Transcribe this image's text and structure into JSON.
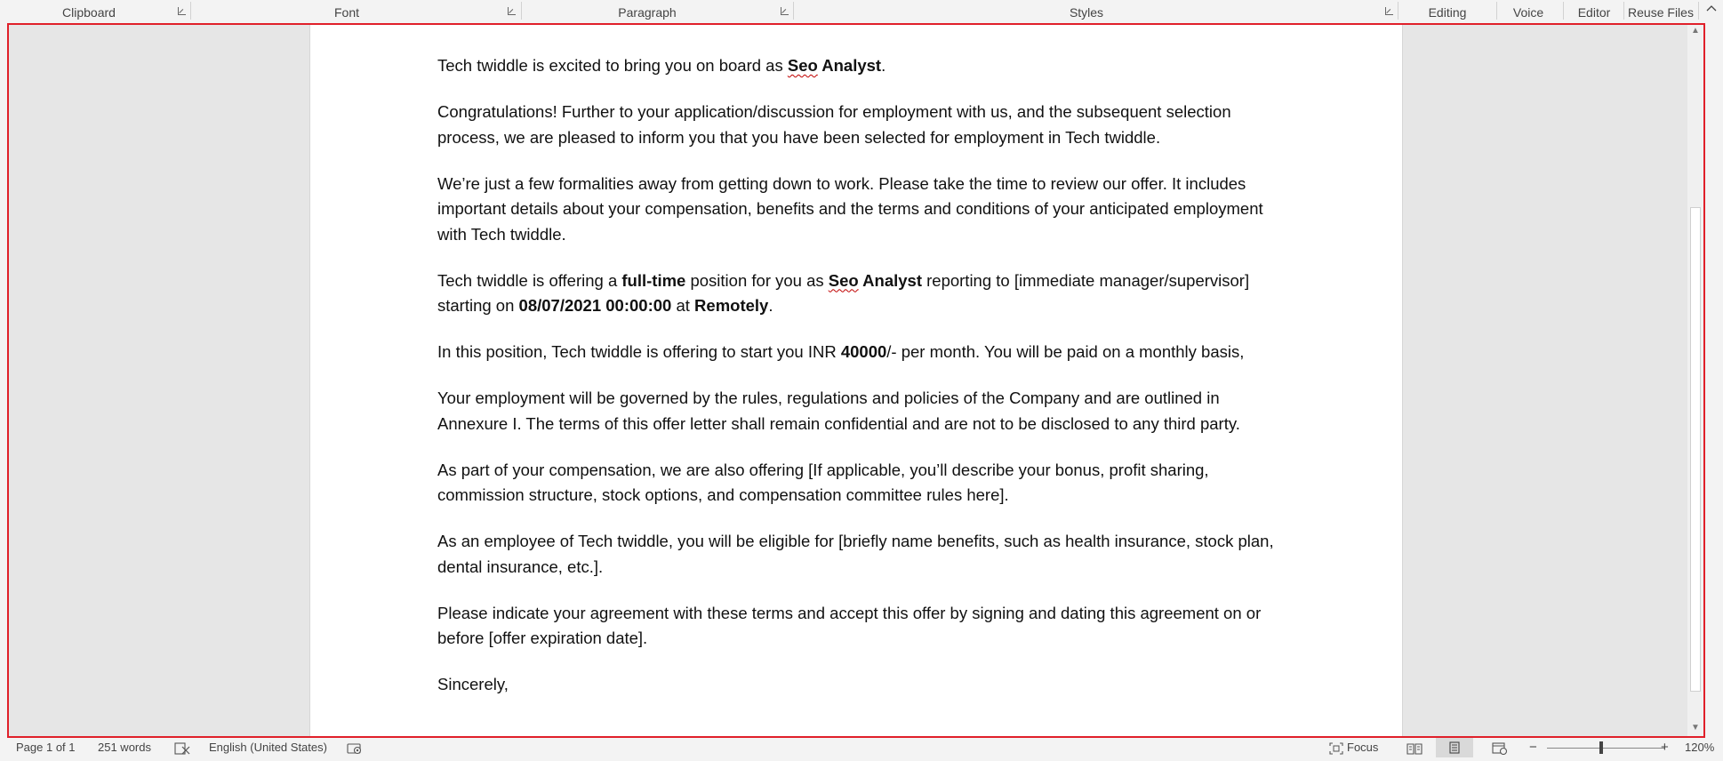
{
  "ribbon": {
    "groups": [
      "Clipboard",
      "Font",
      "Paragraph",
      "Styles",
      "Editing",
      "Voice",
      "Editor",
      "Reuse Files"
    ]
  },
  "document": {
    "paragraphs": {
      "p1": {
        "a": "Tech twiddle is excited to bring you on board as ",
        "role": "Seo",
        "role_rest": " Analyst",
        "end": "."
      },
      "p2": "Congratulations! Further to your application/discussion for employment with us, and the subsequent selection process, we are pleased to inform you that you have been selected for employment in Tech twiddle.",
      "p3": "We’re just a few formalities away from getting down to work. Please take the time to review our offer. It includes important details about your compensation, benefits and the terms and conditions of your anticipated employment with Tech twiddle.",
      "p4": {
        "a": "Tech twiddle is offering a ",
        "type": "full-time",
        "b": " position for you as ",
        "role": "Seo",
        "role_rest": " Analyst",
        "c": " reporting to [immediate manager/supervisor] starting on ",
        "date": "08/07/2021 00:00:00",
        "d": " at ",
        "location": "Remotely",
        "end": "."
      },
      "p5": {
        "a": "In this position, Tech twiddle is offering to start you INR ",
        "amount": "40000",
        "b": "/- per month. You will be paid on a monthly basis,"
      },
      "p6": "Your employment will be governed by the rules, regulations and policies of the Company and are outlined in Annexure I. The terms of this offer letter shall remain confidential and are not to be disclosed to any third party.",
      "p7": "As part of your compensation, we are also offering [If applicable, you’ll describe your bonus, profit sharing, commission structure, stock options, and compensation committee rules here].",
      "p8": "As an employee of Tech twiddle, you will be eligible for [briefly name benefits, such as health insurance, stock plan, dental insurance, etc.].",
      "p9": "Please indicate your agreement with these terms and accept this offer by signing and dating this agreement on or before [offer expiration date].",
      "p10": "Sincerely,"
    }
  },
  "statusbar": {
    "page": "Page 1 of 1",
    "words": "251 words",
    "language": "English (United States)",
    "focus": "Focus",
    "zoom_minus": "−",
    "zoom_plus": "+",
    "zoom": "120%",
    "zoom_fraction": 0.46
  },
  "icons": {
    "collapse": "chevron-up-icon",
    "proofing": "proofing-icon",
    "accessibility": "accessibility-icon",
    "focus": "focus-icon",
    "read_mode": "read-mode-icon",
    "print_layout": "print-layout-icon",
    "web_layout": "web-layout-icon"
  },
  "colors": {
    "selection_border": "#e0202a",
    "spelling_underline": "#c00000"
  }
}
